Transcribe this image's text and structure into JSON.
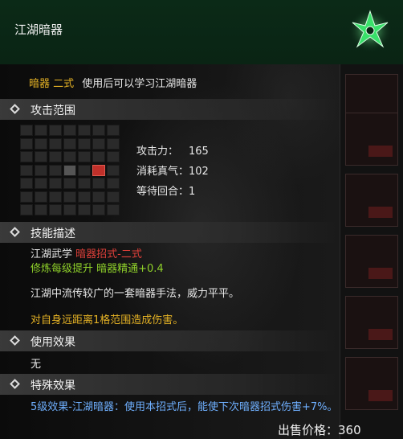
{
  "item": {
    "name": "江湖暗器",
    "icon": "shuriken-icon"
  },
  "usage": {
    "name": "暗器 二式",
    "text": "使用后可以学习江湖暗器"
  },
  "attack_range": {
    "title": "攻击范围",
    "grid": [
      [
        0,
        0,
        0,
        0,
        0,
        0,
        0
      ],
      [
        0,
        0,
        0,
        0,
        0,
        0,
        0
      ],
      [
        0,
        0,
        0,
        0,
        0,
        0,
        0
      ],
      [
        0,
        0,
        0,
        1,
        0,
        2,
        0
      ],
      [
        0,
        0,
        0,
        0,
        0,
        0,
        0
      ],
      [
        0,
        0,
        0,
        0,
        0,
        0,
        0
      ],
      [
        0,
        0,
        0,
        0,
        0,
        0,
        0
      ]
    ],
    "stats": [
      {
        "label": "攻击力：",
        "value": "165"
      },
      {
        "label": "消耗真气：",
        "value": "102"
      },
      {
        "label": "等待回合：",
        "value": "1"
      }
    ]
  },
  "skill_desc": {
    "title": "技能描述",
    "school": "江湖武学",
    "style": "暗器招式-二式",
    "req_text": "修炼每级提升 暗器精通+0.4",
    "flavor": "江湖中流传较广的一套暗器手法，威力平平。",
    "effect": "对自身远距离1格范围造成伤害。"
  },
  "use_effect": {
    "title": "使用效果",
    "text": "无"
  },
  "special_effect": {
    "title": "特殊效果",
    "text": "5级效果-江湖暗器：使用本招式后，能使下次暗器招式伤害+7%。"
  },
  "price": {
    "label": "出售价格：",
    "value": "360"
  },
  "colors": {
    "header_bg": "#0a2414",
    "icon_green": "#39e06a",
    "gold": "#e6b325",
    "red": "#e0403a",
    "green": "#8fd12a",
    "blue": "#6fb0ff",
    "target_cell": "#c0302a"
  }
}
